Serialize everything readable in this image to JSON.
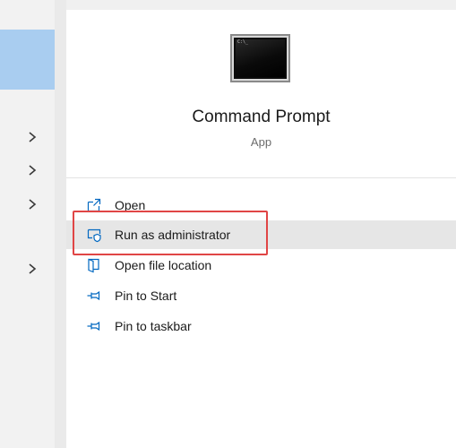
{
  "app": {
    "name": "Command Prompt",
    "type": "App",
    "tile_prompt": "C:\\_"
  },
  "left_pane": {
    "chevrons": [
      "chevron-right-icon",
      "chevron-right-icon",
      "chevron-right-icon",
      "chevron-right-icon"
    ]
  },
  "actions": [
    {
      "label": "Open",
      "icon": "open-icon"
    },
    {
      "label": "Run as administrator",
      "icon": "shield-icon",
      "hovered": true
    },
    {
      "label": "Open file location",
      "icon": "folder-icon"
    },
    {
      "label": "Pin to Start",
      "icon": "pin-icon"
    },
    {
      "label": "Pin to taskbar",
      "icon": "pin-icon"
    }
  ],
  "colors": {
    "accent": "#0067c0",
    "selection": "#a9cdf0",
    "hover": "#e6e6e6",
    "annotation": "#e04545"
  }
}
